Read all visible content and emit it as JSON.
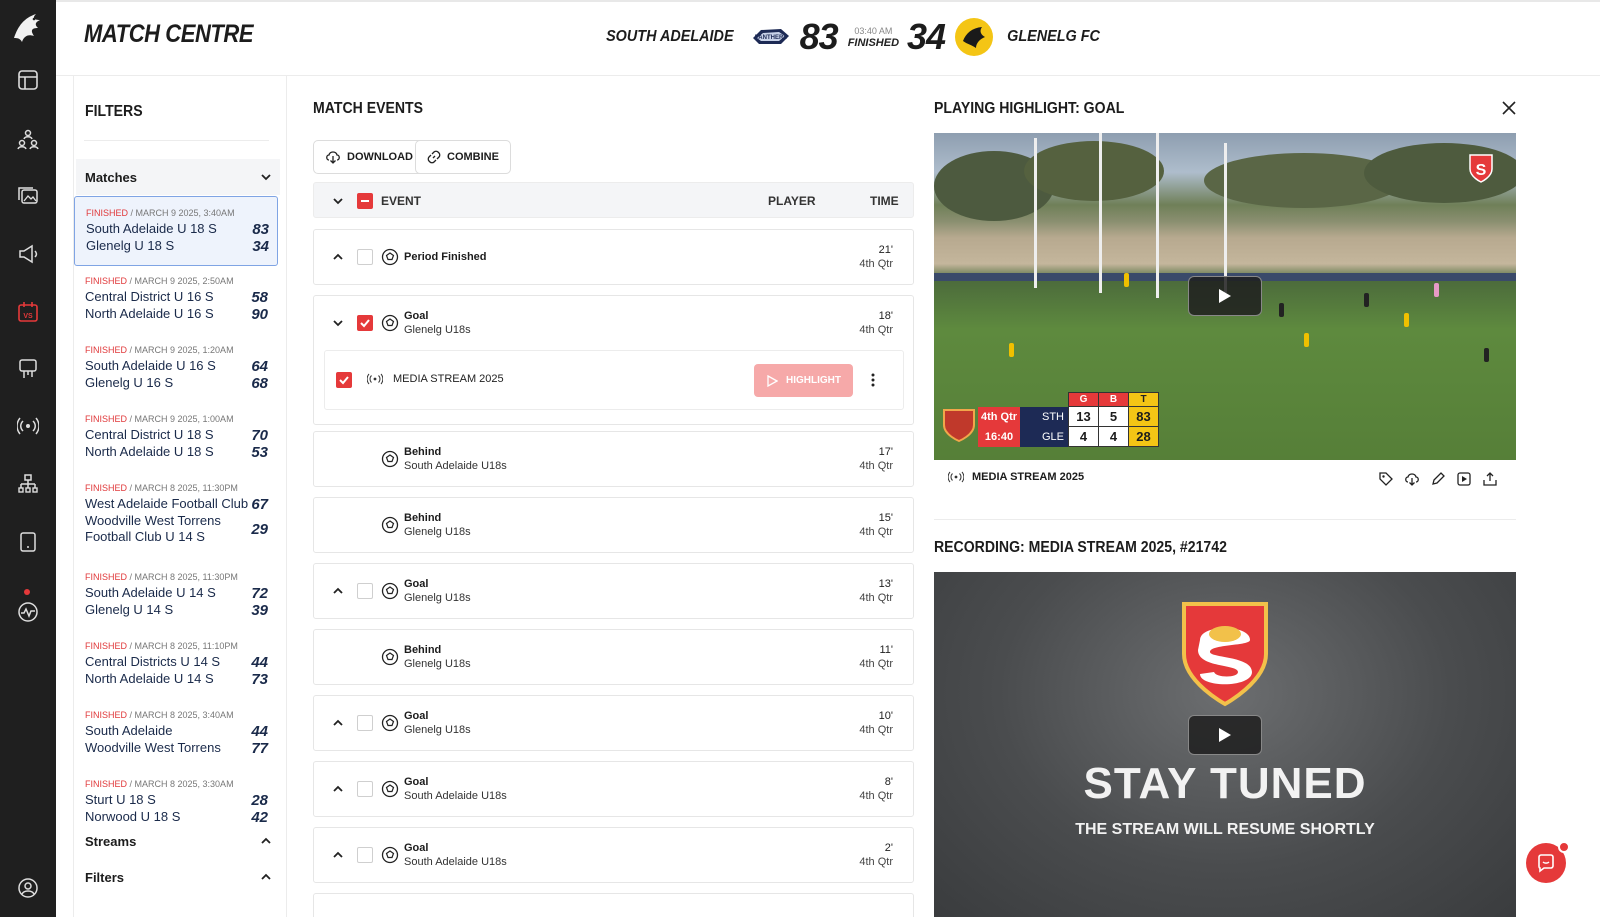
{
  "app": {
    "title": "MATCH CENTRE"
  },
  "scoreboard": {
    "home_team": "SOUTH ADELAIDE",
    "home_badge": "PANTHERS",
    "home_score": "83",
    "time": "03:40 AM",
    "status": "FINISHED",
    "away_score": "34",
    "away_team": "GLENELG FC"
  },
  "filters": {
    "title": "FILTERS",
    "matches_label": "Matches",
    "streams_label": "Streams",
    "filters_label": "Filters",
    "matches": [
      {
        "status": "FINISHED",
        "date": " / MARCH 9 2025, 3:40AM",
        "home": "South Adelaide U 18 S",
        "home_score": "83",
        "away": "Glenelg U 18 S",
        "away_score": "34"
      },
      {
        "status": "FINISHED",
        "date": " / MARCH 9 2025, 2:50AM",
        "home": "Central District U 16 S",
        "home_score": "58",
        "away": "North Adelaide U 16 S",
        "away_score": "90"
      },
      {
        "status": "FINISHED",
        "date": " / MARCH 9 2025, 1:20AM",
        "home": "South Adelaide U 16 S",
        "home_score": "64",
        "away": "Glenelg U 16 S",
        "away_score": "68"
      },
      {
        "status": "FINISHED",
        "date": " / MARCH 9 2025, 1:00AM",
        "home": "Central District U 18 S",
        "home_score": "70",
        "away": "North Adelaide U 18 S",
        "away_score": "53"
      },
      {
        "status": "FINISHED",
        "date": " / MARCH 8 2025, 11:30PM",
        "home": "West Adelaide Football Club",
        "home_score": "67",
        "away_line1": "Woodville West Torrens",
        "away_line2": "Football Club U 14 S",
        "away_score": "29"
      },
      {
        "status": "FINISHED",
        "date": " / MARCH 8 2025, 11:30PM",
        "home": "South Adelaide U 14 S",
        "home_score": "72",
        "away": "Glenelg U 14 S",
        "away_score": "39"
      },
      {
        "status": "FINISHED",
        "date": " / MARCH 8 2025, 11:10PM",
        "home": "Central Districts U 14 S",
        "home_score": "44",
        "away": "North Adelaide U 14 S",
        "away_score": "73"
      },
      {
        "status": "FINISHED",
        "date": " / MARCH 8 2025, 3:40AM",
        "home": "South Adelaide",
        "home_score": "44",
        "away": "Woodville West Torrens",
        "away_score": "77"
      },
      {
        "status": "FINISHED",
        "date": " / MARCH 8 2025, 3:30AM",
        "home": "Sturt U 18 S",
        "home_score": "28",
        "away": "Norwood U 18 S",
        "away_score": "42"
      }
    ]
  },
  "events": {
    "title": "MATCH EVENTS",
    "download_label": "DOWNLOAD",
    "combine_label": "COMBINE",
    "col_event": "EVENT",
    "col_player": "PLAYER",
    "col_time": "TIME",
    "rows": [
      {
        "name": "Period Finished",
        "team": "",
        "minute": "21'",
        "period": "4th Qtr"
      },
      {
        "name": "Goal",
        "team": "Glenelg U18s",
        "minute": "18'",
        "period": "4th Qtr"
      },
      {
        "name": "Behind",
        "team": "South Adelaide U18s",
        "minute": "17'",
        "period": "4th Qtr"
      },
      {
        "name": "Behind",
        "team": "Glenelg U18s",
        "minute": "15'",
        "period": "4th Qtr"
      },
      {
        "name": "Goal",
        "team": "Glenelg U18s",
        "minute": "13'",
        "period": "4th Qtr"
      },
      {
        "name": "Behind",
        "team": "Glenelg U18s",
        "minute": "11'",
        "period": "4th Qtr"
      },
      {
        "name": "Goal",
        "team": "Glenelg U18s",
        "minute": "10'",
        "period": "4th Qtr"
      },
      {
        "name": "Goal",
        "team": "South Adelaide U18s",
        "minute": "8'",
        "period": "4th Qtr"
      },
      {
        "name": "Goal",
        "team": "South Adelaide U18s",
        "minute": "2'",
        "period": "4th Qtr"
      }
    ],
    "stream": {
      "label": "MEDIA STREAM 2025",
      "highlight_label": "HIGHLIGHT"
    }
  },
  "player": {
    "title": "PLAYING HIGHLIGHT: GOAL",
    "stream_label": "MEDIA STREAM 2025",
    "broadcast": {
      "quarter": "4th Qtr",
      "clock": "16:40",
      "home_abbr": "STH",
      "away_abbr": "GLE",
      "head_g": "G",
      "head_b": "B",
      "head_t": "T",
      "home_g": "13",
      "home_b": "5",
      "home_t": "83",
      "away_g": "4",
      "away_b": "4",
      "away_t": "28"
    }
  },
  "recording": {
    "title": "RECORDING: MEDIA STREAM 2025, #21742",
    "headline": "STAY TUNED",
    "subline": "THE STREAM WILL RESUME SHORTLY"
  },
  "colors": {
    "accent": "#e5393a",
    "rail": "#1f1f1f",
    "selected_bg": "#eef3fc"
  }
}
